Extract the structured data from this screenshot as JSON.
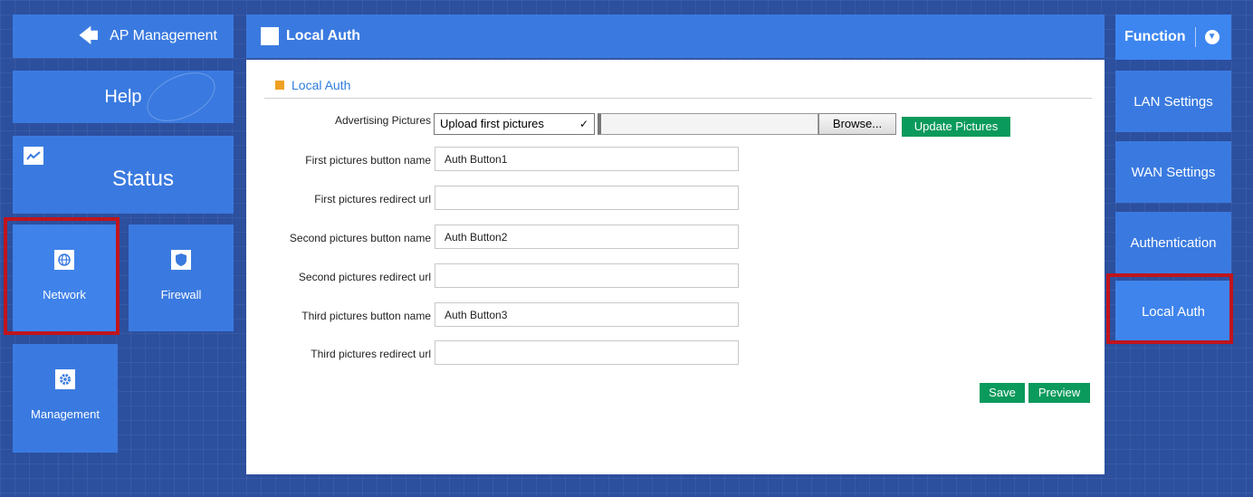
{
  "left_nav": {
    "ap_management": "AP Management",
    "help": "Help",
    "status": "Status",
    "network": "Network",
    "firewall": "Firewall",
    "management": "Management"
  },
  "panel": {
    "header_title": "Local Auth",
    "section_title": "Local Auth",
    "form": {
      "advertising_label": "Advertising Pictures",
      "advertising_selected": "Upload first pictures",
      "browse_label": "Browse...",
      "update_label": "Update Pictures",
      "first_button_label": "First pictures button name",
      "first_button_value": "Auth Button1",
      "first_redirect_label": "First pictures redirect url",
      "first_redirect_value": "",
      "second_button_label": "Second pictures button name",
      "second_button_value": "Auth Button2",
      "second_redirect_label": "Second pictures redirect url",
      "second_redirect_value": "",
      "third_button_label": "Third pictures button name",
      "third_button_value": "Auth Button3",
      "third_redirect_label": "Third pictures redirect url",
      "third_redirect_value": ""
    },
    "save_label": "Save",
    "preview_label": "Preview"
  },
  "right_nav": {
    "function": "Function",
    "items": [
      "LAN Settings",
      "WAN Settings",
      "Authentication",
      "Local Auth"
    ]
  },
  "colors": {
    "tile": "#3a7ae0",
    "highlight_border": "#c0141c",
    "green_button": "#0a9a5c",
    "section_accent": "#f0a020"
  }
}
